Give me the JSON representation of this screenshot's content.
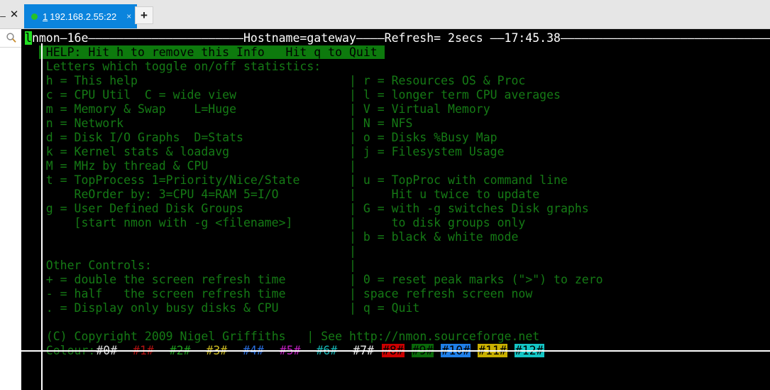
{
  "window": {
    "minimize_label": "–",
    "close_label": "✕",
    "search_icon": "search-icon"
  },
  "tabbar": {
    "tab": {
      "number": "1",
      "title": "192.168.2.55:22",
      "close_label": "×",
      "status": "connected"
    },
    "new_tab_label": "+"
  },
  "terminal": {
    "header": {
      "left_cursor_char": "l",
      "line": "nmon—16e——————————————————————Hostname=gateway————Refresh= 2secs ——17:45.38———————————————————————————————————",
      "app": "nmon—16e",
      "hostname": "Hostname=gateway",
      "refresh": "Refresh= 2secs",
      "time": "17:45.38"
    },
    "help_banner": " HELP: Hit h to remove this Info   Hit q to Quit ",
    "section_title": " Letters which toggle on/off statistics:",
    "left_column": [
      " h = This help",
      " c = CPU Util  C = wide view",
      " m = Memory & Swap    L=Huge",
      " n = Network",
      " d = Disk I/O Graphs  D=Stats",
      " k = Kernel stats & loadavg",
      " M = MHz by thread & CPU",
      " t = TopProcess 1=Priority/Nice/State",
      "     ReOrder by: 3=CPU 4=RAM 5=I/O",
      " g = User Defined Disk Groups",
      "     [start nmon with -g <filename>]",
      "",
      "",
      " Other Controls:",
      " + = double the screen refresh time",
      " - = half   the screen refresh time",
      " . = Display only busy disks & CPU"
    ],
    "right_column": [
      "| r = Resources OS & Proc",
      "| l = longer term CPU averages",
      "| V = Virtual Memory",
      "| N = NFS",
      "| o = Disks %Busy Map",
      "| j = Filesystem Usage",
      "|",
      "| u = TopProc with command line",
      "|     Hit u twice to update",
      "| G = with -g switches Disk graphs",
      "|     to disk groups only",
      "| b = black & white mode",
      "|",
      "|",
      "| 0 = reset peak marks (\">\") to zero",
      "| space refresh screen now",
      "| q = Quit"
    ],
    "copyright_left": " (C) Copyright 2009 Nigel Griffiths",
    "copyright_right": "| See http://nmon.sourceforge.net",
    "colour_label": " Colour:",
    "swatches": [
      {
        "label": "#0#",
        "fg": "#dcdcdc",
        "bg": "transparent"
      },
      {
        "label": "#1#",
        "fg": "#b41212",
        "bg": "transparent"
      },
      {
        "label": "#2#",
        "fg": "#1f9e1f",
        "bg": "transparent"
      },
      {
        "label": "#3#",
        "fg": "#ccbb22",
        "bg": "transparent"
      },
      {
        "label": "#4#",
        "fg": "#2a6fe0",
        "bg": "transparent"
      },
      {
        "label": "#5#",
        "fg": "#c020c0",
        "bg": "transparent"
      },
      {
        "label": "#6#",
        "fg": "#17b6b6",
        "bg": "transparent"
      },
      {
        "label": "#7#",
        "fg": "#e8e8e8",
        "bg": "transparent"
      },
      {
        "label": "#8#",
        "fg": "#000000",
        "bg": "#cc0000"
      },
      {
        "label": "#9#",
        "fg": "#000000",
        "bg": "#096909"
      },
      {
        "label": "#10#",
        "fg": "#000000",
        "bg": "#1f7fe8"
      },
      {
        "label": "#11#",
        "fg": "#000000",
        "bg": "#c9b000"
      },
      {
        "label": "#12#",
        "fg": "#000000",
        "bg": "#13c6c6"
      }
    ]
  }
}
